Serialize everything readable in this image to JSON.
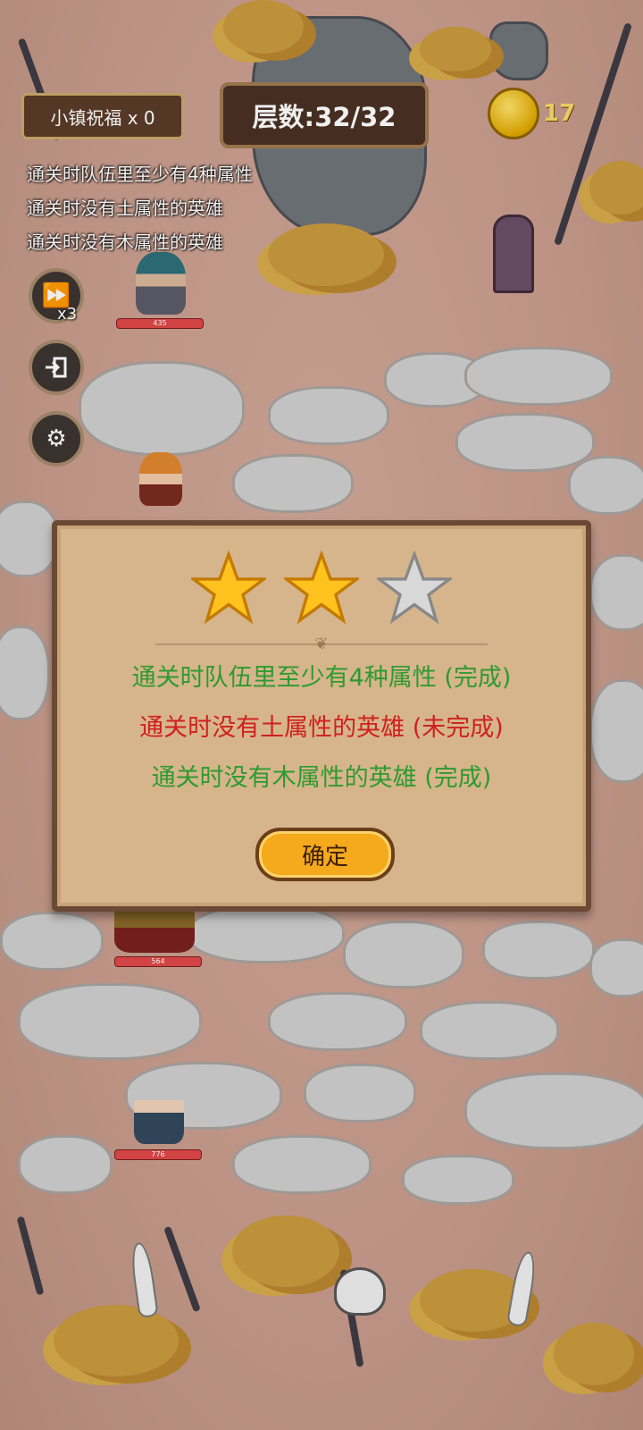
{
  "hud": {
    "blessing": "小镇祝福 x 0",
    "floor": "层数:32/32",
    "coins": "17",
    "speed_label": "x3"
  },
  "objectives": [
    "通关时队伍里至少有4种属性",
    "通关时没有土属性的英雄",
    "通关时没有木属性的英雄"
  ],
  "heroes": [
    {
      "hp": "435"
    },
    {
      "hp": "564"
    },
    {
      "hp": "776"
    }
  ],
  "dialog": {
    "stars_earned": 2,
    "stars_total": 3,
    "results": [
      {
        "text": "通关时队伍里至少有4种属性 (完成)",
        "color": "#2f9a2f"
      },
      {
        "text": "通关时没有土属性的英雄 (未完成)",
        "color": "#d02020"
      },
      {
        "text": "通关时没有木属性的英雄 (完成)",
        "color": "#2f9a2f"
      }
    ],
    "confirm": "确定"
  },
  "icons": {
    "speed": "fast-forward-icon",
    "exit": "exit-icon",
    "settings": "gear-icon",
    "coin": "coin-icon",
    "star_filled": "star-gold-icon",
    "star_empty": "star-silver-icon"
  }
}
